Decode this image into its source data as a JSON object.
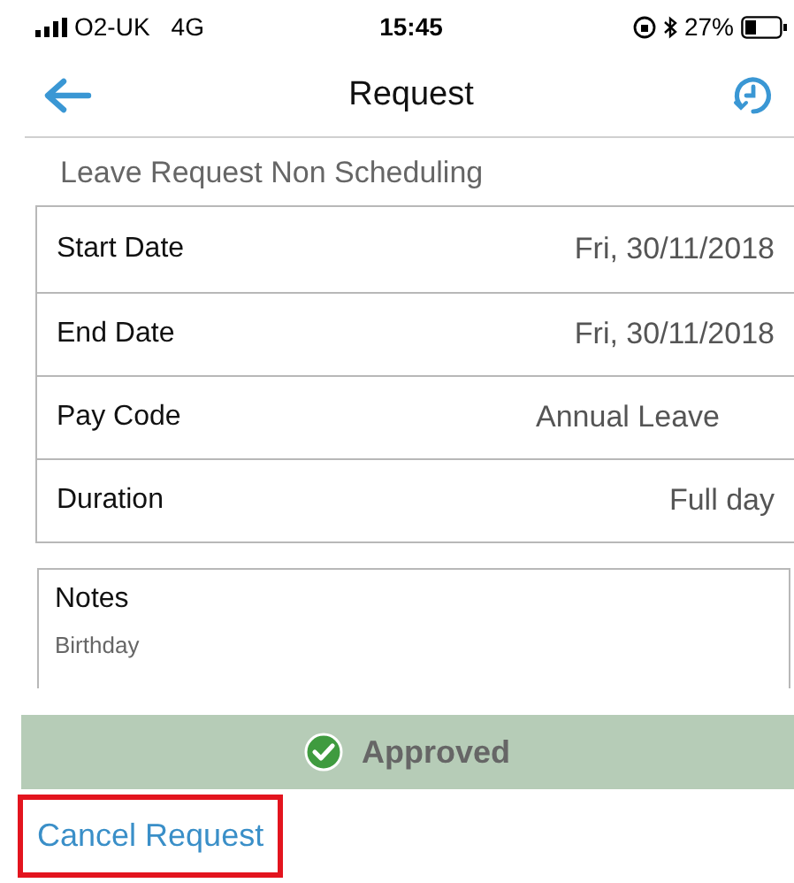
{
  "status_bar": {
    "carrier": "O2-UK",
    "network": "4G",
    "time": "15:45",
    "battery": "27%"
  },
  "nav": {
    "title": "Request"
  },
  "subtitle": "Leave Request Non Scheduling",
  "details": [
    {
      "label": "Start Date",
      "value": "Fri, 30/11/2018"
    },
    {
      "label": "End Date",
      "value": "Fri, 30/11/2018"
    },
    {
      "label": "Pay Code",
      "value": "Annual Leave"
    },
    {
      "label": "Duration",
      "value": "Full day"
    }
  ],
  "notes": {
    "label": "Notes",
    "text": "Birthday"
  },
  "status": {
    "label": "Approved",
    "kind": "approved"
  },
  "cancel": {
    "label": "Cancel Request",
    "highlighted": true
  }
}
